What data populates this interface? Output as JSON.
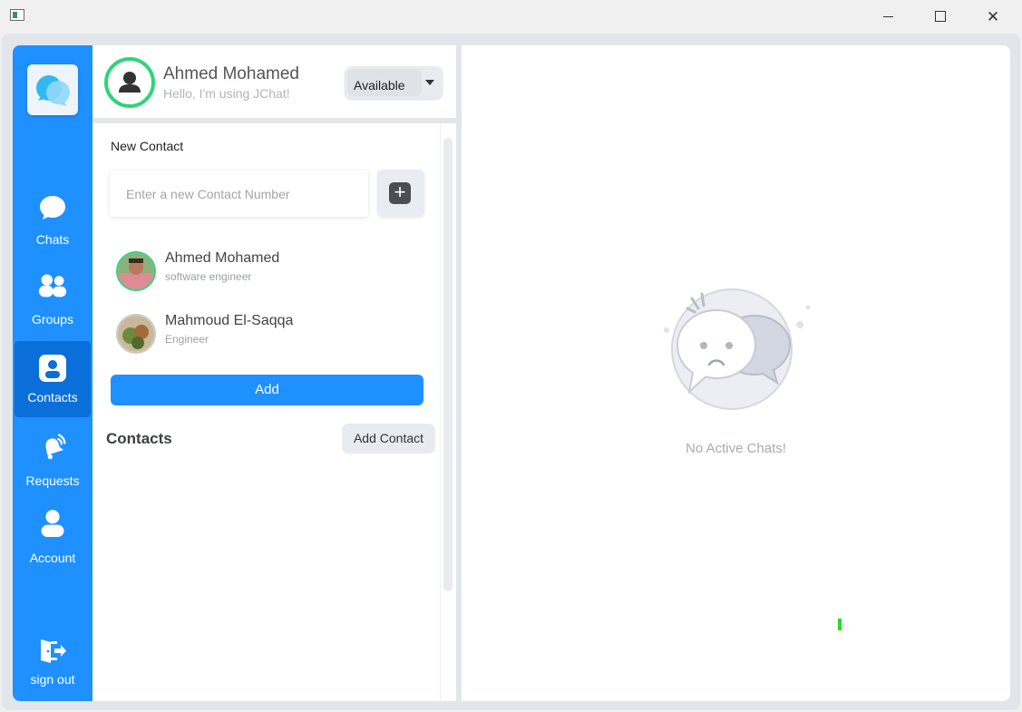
{
  "window": {
    "controls": {
      "minimize_icon": "minimize-icon",
      "maximize_icon": "maximize-icon",
      "close_icon": "close-icon"
    }
  },
  "sidebar": {
    "accent": "#1e90ff",
    "items": [
      {
        "label": "Chats",
        "icon": "chat-bubble-icon"
      },
      {
        "label": "Groups",
        "icon": "groups-icon"
      },
      {
        "label": "Contacts",
        "icon": "contact-card-icon",
        "active": true
      },
      {
        "label": "Requests",
        "icon": "bell-ringing-icon"
      },
      {
        "label": "Account",
        "icon": "user-icon"
      }
    ],
    "sign_out": {
      "label": "sign out",
      "icon": "sign-out-icon"
    }
  },
  "profile": {
    "name": "Ahmed Mohamed",
    "status_message": "Hello, I'm using JChat!",
    "availability": "Available",
    "ring_color": "#2ed47a"
  },
  "new_contact": {
    "title": "New Contact",
    "input_placeholder": "Enter a new Contact Number",
    "input_value": "",
    "add_icon": "plus-icon",
    "pending": [
      {
        "name": "Ahmed Mohamed",
        "role": "software engineer"
      },
      {
        "name": "Mahmoud El-Saqqa",
        "role": "Engineer"
      }
    ],
    "add_label": "Add"
  },
  "contacts": {
    "heading": "Contacts",
    "add_contact_label": "Add Contact"
  },
  "chat_area": {
    "empty_message": "No Active Chats!"
  }
}
